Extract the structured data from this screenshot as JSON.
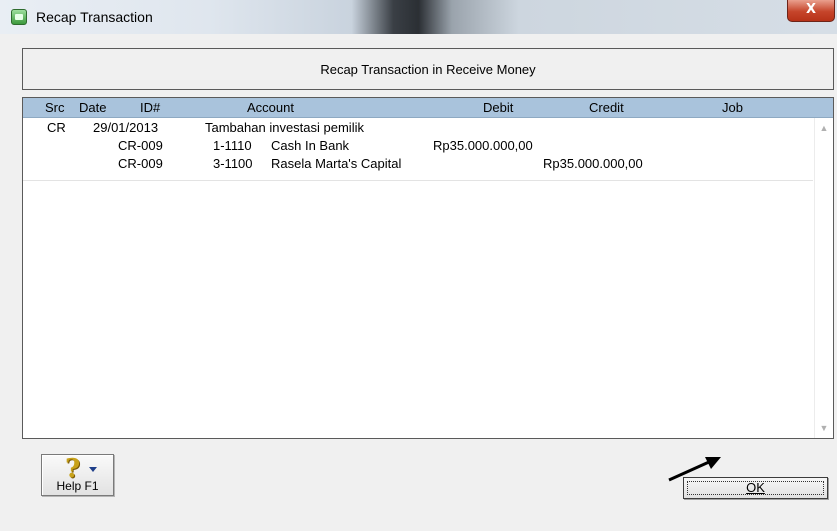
{
  "window": {
    "title": "Recap Transaction",
    "close_glyph": "X"
  },
  "header": {
    "title": "Recap Transaction in Receive Money"
  },
  "grid": {
    "columns": {
      "src": "Src",
      "date": "Date",
      "id": "ID#",
      "account": "Account",
      "debit": "Debit",
      "credit": "Credit",
      "job": "Job"
    },
    "rows": [
      {
        "src": "CR",
        "date": "29/01/2013",
        "id": "",
        "account_no": "",
        "account": "Tambahan investasi pemilik",
        "debit": "",
        "credit": ""
      },
      {
        "src": "",
        "date": "",
        "id": "CR-009",
        "account_no": "1-1110",
        "account": "Cash In Bank",
        "debit": "Rp35.000.000,00",
        "credit": ""
      },
      {
        "src": "",
        "date": "",
        "id": "CR-009",
        "account_no": "3-1100",
        "account": "Rasela Marta's Capital",
        "debit": "",
        "credit": "Rp35.000.000,00"
      }
    ]
  },
  "buttons": {
    "help_label": "Help F1",
    "ok_label": "OK"
  },
  "icons": {
    "app": "recap-app-icon",
    "help": "question-mark-icon",
    "pointer": "arrow-pointer-icon"
  }
}
